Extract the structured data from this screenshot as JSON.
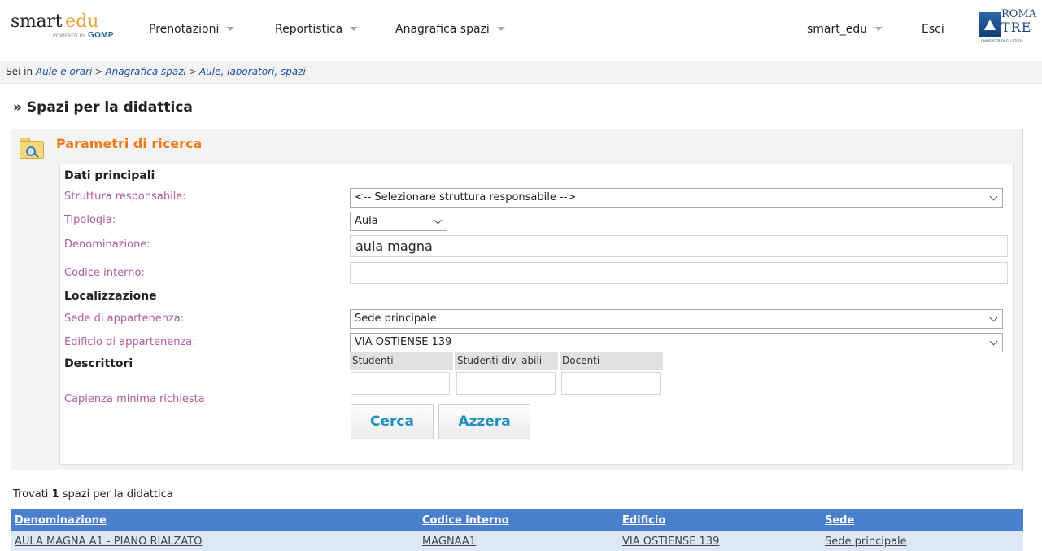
{
  "header": {
    "logo": {
      "smart": "smart",
      "edu": "edu",
      "powered_by": "POWERED BY",
      "gomp": "GOMP"
    },
    "nav": [
      {
        "label": "Prenotazioni"
      },
      {
        "label": "Reportistica"
      },
      {
        "label": "Anagrafica spazi"
      }
    ],
    "user_menu": "smart_edu",
    "logout": "Esci",
    "university_logo": {
      "line1": "ROMA",
      "line2": "TRE",
      "sub": "UNIVERSITÀ DEGLI STUDI"
    }
  },
  "breadcrumb": {
    "prefix": "Sei in",
    "items": [
      "Aule e orari",
      "Anagrafica spazi",
      "Aule, laboratori, spazi"
    ],
    "separator": ">"
  },
  "page_title": "» Spazi per la didattica",
  "search_panel": {
    "title": "Parametri di ricerca",
    "sections": {
      "main": "Dati principali",
      "location": "Localizzazione",
      "descriptors": "Descrittori"
    },
    "fields": {
      "struttura": {
        "label": "Struttura responsabile:",
        "value": "<-- Selezionare struttura responsabile -->"
      },
      "tipologia": {
        "label": "Tipologia:",
        "value": "Aula"
      },
      "denominazione": {
        "label": "Denominazione:",
        "value": "aula magna"
      },
      "codice": {
        "label": "Codice interno:",
        "value": ""
      },
      "sede": {
        "label": "Sede di appartenenza:",
        "value": "Sede principale"
      },
      "edificio": {
        "label": "Edificio di appartenenza:",
        "value": "VIA OSTIENSE 139"
      },
      "capienza": {
        "label": "Capienza minima richiesta",
        "columns": [
          "Studenti",
          "Studenti div. abili",
          "Docenti"
        ]
      }
    },
    "buttons": {
      "search": "Cerca",
      "reset": "Azzera"
    }
  },
  "results": {
    "prefix": "Trovati",
    "count": "1",
    "suffix": "spazi per la didattica",
    "columns": [
      "Denominazione",
      "Codice interno",
      "Edificio",
      "Sede"
    ],
    "rows": [
      [
        "AULA MAGNA A1 - PIANO RIALZATO",
        "MAGNAA1",
        "VIA OSTIENSE 139",
        "Sede principale"
      ]
    ]
  },
  "colors": {
    "accent_orange": "#f07a16",
    "label_purple": "#b05c9b",
    "link_blue": "#1f4fa8",
    "table_header": "#4a7fcd",
    "table_row": "#dde8f7",
    "button_text": "#1c8fbf"
  }
}
